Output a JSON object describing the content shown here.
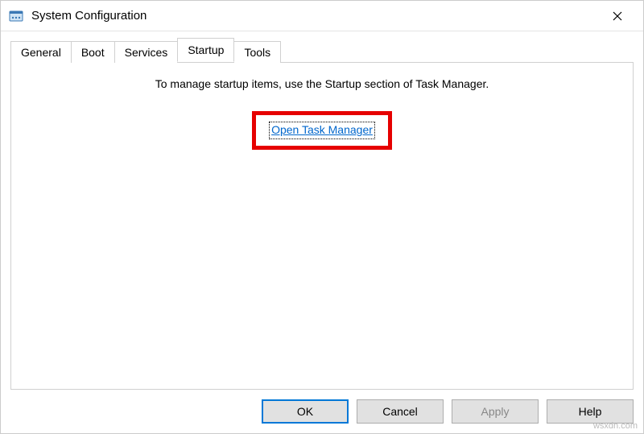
{
  "window": {
    "title": "System Configuration"
  },
  "tabs": {
    "general": "General",
    "boot": "Boot",
    "services": "Services",
    "startup": "Startup",
    "tools": "Tools"
  },
  "content": {
    "startup_message": "To manage startup items, use the Startup section of Task Manager.",
    "open_link": "Open Task Manager"
  },
  "buttons": {
    "ok": "OK",
    "cancel": "Cancel",
    "apply": "Apply",
    "help": "Help"
  },
  "watermark": "wsxdn.com"
}
